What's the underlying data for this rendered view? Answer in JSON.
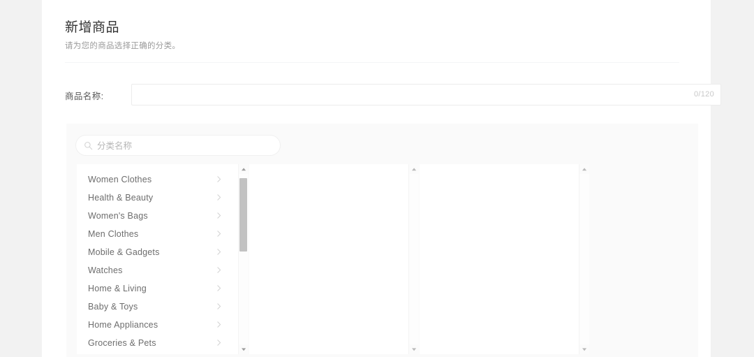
{
  "page": {
    "title": "新增商品",
    "subtitle": "请为您的商品选择正确的分类。",
    "bg_color": "#f2f2f2",
    "card_color": "#ffffff",
    "panel_color": "#fafafa"
  },
  "product_name_field": {
    "label": "商品名称:",
    "value": "",
    "placeholder": "",
    "counter": "0/120",
    "max_length": 120
  },
  "category_search": {
    "value": "",
    "placeholder": "分类名称",
    "icon": "search-icon"
  },
  "category_columns": [
    {
      "name": "column-1",
      "items": [
        {
          "label": "Women Clothes",
          "has_children": true
        },
        {
          "label": "Health & Beauty",
          "has_children": true
        },
        {
          "label": "Women's Bags",
          "has_children": true
        },
        {
          "label": "Men Clothes",
          "has_children": true
        },
        {
          "label": "Mobile & Gadgets",
          "has_children": true
        },
        {
          "label": "Watches",
          "has_children": true
        },
        {
          "label": "Home & Living",
          "has_children": true
        },
        {
          "label": "Baby & Toys",
          "has_children": true
        },
        {
          "label": "Home Appliances",
          "has_children": true
        },
        {
          "label": "Groceries & Pets",
          "has_children": true
        }
      ],
      "scrollbar": {
        "has_thumb": true,
        "up_icon": "caret-up-icon",
        "down_icon": "caret-down-icon"
      }
    },
    {
      "name": "column-2",
      "items": [],
      "scrollbar": {
        "has_thumb": false,
        "up_icon": "caret-up-icon",
        "down_icon": "caret-down-icon"
      }
    },
    {
      "name": "column-3",
      "items": [],
      "scrollbar": {
        "has_thumb": false,
        "up_icon": "caret-up-icon",
        "down_icon": "caret-down-icon"
      }
    }
  ]
}
